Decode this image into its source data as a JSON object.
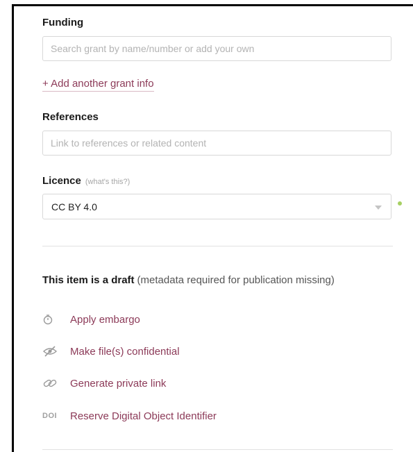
{
  "funding": {
    "heading": "Funding",
    "placeholder": "Search grant by name/number or add your own",
    "add_link": "+ Add another grant info"
  },
  "references": {
    "heading": "References",
    "placeholder": "Link to references or related content"
  },
  "licence": {
    "heading": "Licence",
    "hint": "(what's this?)",
    "selected": "CC BY 4.0",
    "status_color": "#a6d063"
  },
  "draft": {
    "title": "This item is a draft",
    "note": "(metadata required for publication missing)"
  },
  "actions": [
    {
      "icon": "stopwatch-icon",
      "label": "Apply embargo"
    },
    {
      "icon": "eye-off-icon",
      "label": "Make file(s) confidential"
    },
    {
      "icon": "link-icon",
      "label": "Generate private link"
    },
    {
      "icon": "doi-icon",
      "icon_text": "DOI",
      "label": "Reserve Digital Object Identifier"
    }
  ],
  "colors": {
    "link": "#8c3a58",
    "heading": "#1a1a1a",
    "placeholder": "#b3b3b3",
    "border": "#d8d8d8"
  }
}
